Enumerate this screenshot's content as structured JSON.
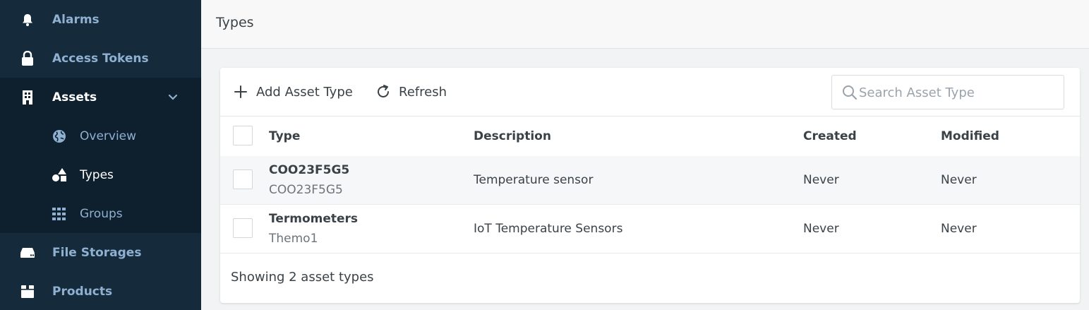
{
  "sidebar": {
    "items": [
      {
        "label": "Alarms",
        "icon": "bell-icon"
      },
      {
        "label": "Access Tokens",
        "icon": "lock-icon"
      },
      {
        "label": "Assets",
        "icon": "building-icon"
      },
      {
        "label": "Overview",
        "icon": "globe-icon"
      },
      {
        "label": "Types",
        "icon": "shapes-icon"
      },
      {
        "label": "Groups",
        "icon": "grid-icon"
      },
      {
        "label": "File Storages",
        "icon": "drive-icon"
      },
      {
        "label": "Products",
        "icon": "box-icon"
      }
    ]
  },
  "header": {
    "title": "Types"
  },
  "toolbar": {
    "add_label": "Add Asset Type",
    "refresh_label": "Refresh",
    "search_placeholder": "Search Asset Type",
    "search_value": ""
  },
  "table": {
    "columns": [
      "Type",
      "Description",
      "Created",
      "Modified"
    ],
    "rows": [
      {
        "name": "COO23F5G5",
        "id": "COO23F5G5",
        "description": "Temperature sensor",
        "created": "Never",
        "modified": "Never"
      },
      {
        "name": "Termometers",
        "id": "Themo1",
        "description": "IoT Temperature Sensors",
        "created": "Never",
        "modified": "Never"
      }
    ]
  },
  "footer": {
    "summary": "Showing 2 asset types"
  },
  "colors": {
    "sidebar_bg": "#152b3c",
    "sidebar_active_bg": "#0e1f2d",
    "sidebar_label": "#8fb0d0",
    "text": "#3b4247"
  }
}
